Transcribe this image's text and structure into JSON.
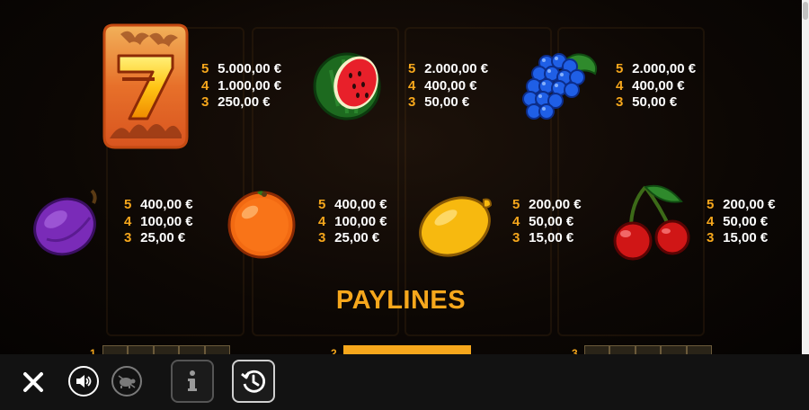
{
  "symbols": [
    {
      "name": "seven",
      "payouts": [
        {
          "count": "5",
          "amount": "5.000,00 €"
        },
        {
          "count": "4",
          "amount": "1.000,00 €"
        },
        {
          "count": "3",
          "amount": "250,00 €"
        }
      ]
    },
    {
      "name": "watermelon",
      "payouts": [
        {
          "count": "5",
          "amount": "2.000,00 €"
        },
        {
          "count": "4",
          "amount": "400,00 €"
        },
        {
          "count": "3",
          "amount": "50,00 €"
        }
      ]
    },
    {
      "name": "grapes",
      "payouts": [
        {
          "count": "5",
          "amount": "2.000,00 €"
        },
        {
          "count": "4",
          "amount": "400,00 €"
        },
        {
          "count": "3",
          "amount": "50,00 €"
        }
      ]
    },
    {
      "name": "plum",
      "payouts": [
        {
          "count": "5",
          "amount": "400,00 €"
        },
        {
          "count": "4",
          "amount": "100,00 €"
        },
        {
          "count": "3",
          "amount": "25,00 €"
        }
      ]
    },
    {
      "name": "orange",
      "payouts": [
        {
          "count": "5",
          "amount": "400,00 €"
        },
        {
          "count": "4",
          "amount": "100,00 €"
        },
        {
          "count": "3",
          "amount": "25,00 €"
        }
      ]
    },
    {
      "name": "lemon",
      "payouts": [
        {
          "count": "5",
          "amount": "200,00 €"
        },
        {
          "count": "4",
          "amount": "50,00 €"
        },
        {
          "count": "3",
          "amount": "15,00 €"
        }
      ]
    },
    {
      "name": "cherries",
      "payouts": [
        {
          "count": "5",
          "amount": "200,00 €"
        },
        {
          "count": "4",
          "amount": "50,00 €"
        },
        {
          "count": "3",
          "amount": "15,00 €"
        }
      ]
    }
  ],
  "paylines": {
    "title": "PAYLINES",
    "items": [
      {
        "number": "1"
      },
      {
        "number": "2"
      },
      {
        "number": "3"
      }
    ]
  },
  "toolbar": {
    "close_icon": "close-icon",
    "sound_icon": "speaker-icon",
    "turbo_icon": "turtle-icon",
    "info_icon": "info-icon",
    "history_icon": "history-icon",
    "info_glyph": "i"
  },
  "colors": {
    "accent": "#f6a71c",
    "text": "#ffffff",
    "toolbar": "#121212"
  }
}
